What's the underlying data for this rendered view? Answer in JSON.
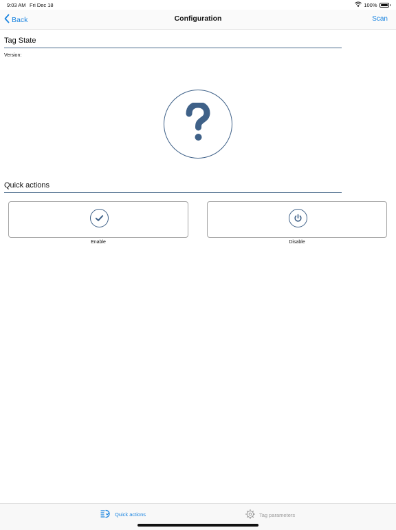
{
  "status_bar": {
    "time": "9:03 AM",
    "date": "Fri Dec 18",
    "battery": "100%",
    "icons": [
      "wifi-icon",
      "battery-icon"
    ]
  },
  "nav": {
    "back_label": "Back",
    "title": "Configuration",
    "scan_label": "Scan"
  },
  "tag_state": {
    "title": "Tag State",
    "version_label": "Version:",
    "state_icon": "question-mark-icon"
  },
  "quick_actions": {
    "title": "Quick actions",
    "actions": [
      {
        "label": "Enable",
        "icon": "checkmark-icon"
      },
      {
        "label": "Disable",
        "icon": "power-icon"
      }
    ]
  },
  "tab_bar": {
    "tabs": [
      {
        "label": "Quick actions",
        "icon": "quick-actions-icon",
        "active": true
      },
      {
        "label": "Tag parameters",
        "icon": "gear-icon",
        "active": false
      }
    ]
  },
  "colors": {
    "accent": "#1a84e0",
    "icon_blue": "#3f6188",
    "divider": "#4b6b8c",
    "inactive": "#9a9a9a"
  }
}
